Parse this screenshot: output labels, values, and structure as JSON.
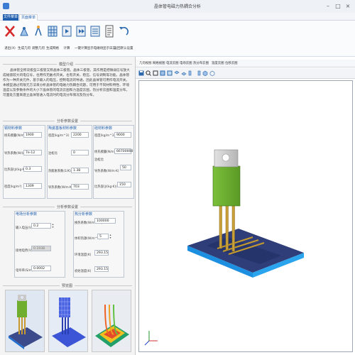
{
  "window": {
    "title": "晶体管电磁力热耦合分析"
  },
  "ribbon_tabs": [
    "文件菜单",
    "页面菜单"
  ],
  "toolbar": {
    "items": [
      {
        "label": "退出(X)",
        "icon": "close-icon"
      },
      {
        "label": "生成几何",
        "icon": "geometry-icon"
      },
      {
        "label": "调整几何",
        "icon": "adjust-geometry-icon"
      },
      {
        "label": "生成网格",
        "icon": "mesh-icon"
      },
      {
        "label": "计算",
        "icon": "compute-icon"
      },
      {
        "label": "一键计算",
        "icon": "one-click-compute-icon"
      },
      {
        "label": "显示电磁场",
        "icon": "em-field-icon"
      },
      {
        "label": "显示日志",
        "icon": "log-icon"
      },
      {
        "label": "返回默认设置",
        "icon": "reset-icon"
      }
    ]
  },
  "left": {
    "intro_header": "模型介绍",
    "intro_text": "晶体管全称双极型三极管又称晶体三极管。晶体三极管，其作用是把微弱信号放大成幅值较大的电信号，也用作无触点开关。也有开关、稳压、信号调制等功能。晶体管作为一种开关元件，基于输入的电压，控制电流的导通，因此晶体管可用作电流开关。本模型通过有限元方法来分析晶体管的电磁力热耦合问题，可用于不同材料特性、环境温度以及参数条件的大小下晶体管的电流云图和力温度云图，热分析云图和温度分布，可面处方面来建立晶体管通入电流时的电流分布情况及热分布。",
    "geom_header": "分析参数设置",
    "group_copper": {
      "title": "铜材料参数",
      "fields": [
        {
          "label": "杨氏模量(N/m^2)",
          "value": "1900"
        },
        {
          "label": "导热系数(W/(m·K))",
          "value": "7e-12"
        },
        {
          "label": "比热容(J/(kg·K))",
          "value": "0.3"
        },
        {
          "label": "密度(kg/m³)",
          "value": "1309"
        }
      ]
    },
    "group_substrate": {
      "title": "陶瓷基板材料参数",
      "fields": [
        {
          "label": "密度(kg/m^3)",
          "value": "2200"
        },
        {
          "label": "泊松比",
          "value": "0"
        },
        {
          "label": "热膨胀系数(1/K)",
          "value": "1.38"
        },
        {
          "label": "导热系数(W/m·K)",
          "value": "703"
        }
      ]
    },
    "group_chip": {
      "title": "硅材料参数",
      "fields": [
        {
          "label": "密度(kg/m^3)",
          "value": "9000"
        },
        {
          "label": "杨氏模量(N/m^2)",
          "value": "66700000"
        },
        {
          "label": "泊松比",
          "value": "0"
        },
        {
          "label": "导热系数(W/m·K)",
          "value": "50"
        },
        {
          "label": "比热容(J/(kg·K))",
          "value": "150"
        }
      ]
    },
    "analysis_header": "分析参数设置",
    "group_electric": {
      "title": "电场分析参数",
      "fields": [
        {
          "label": "输入电压(V)",
          "value": "0.2",
          "stepper": true
        },
        {
          "label": "接地电势(V)",
          "value": "0.1938",
          "disabled": true
        },
        {
          "label": "电导率(S/m)",
          "value": "0.0002"
        }
      ]
    },
    "group_thermal": {
      "title": "热分析参数",
      "fields": [
        {
          "label": "换热系数(W/m^2K)",
          "value": "100000"
        },
        {
          "label": "体积热源(W/m^3)",
          "value": "5",
          "stepper": true
        },
        {
          "label": "环境温度(K)",
          "value": "293.15"
        },
        {
          "label": "初始温度(K)",
          "value": "293.15"
        }
      ]
    },
    "preview_header": "预览图"
  },
  "right": {
    "tabs": [
      "几何视图",
      "网格视图",
      "电流云图",
      "电场云图",
      "热分布云图",
      "温度云图",
      "位移云图"
    ]
  }
}
